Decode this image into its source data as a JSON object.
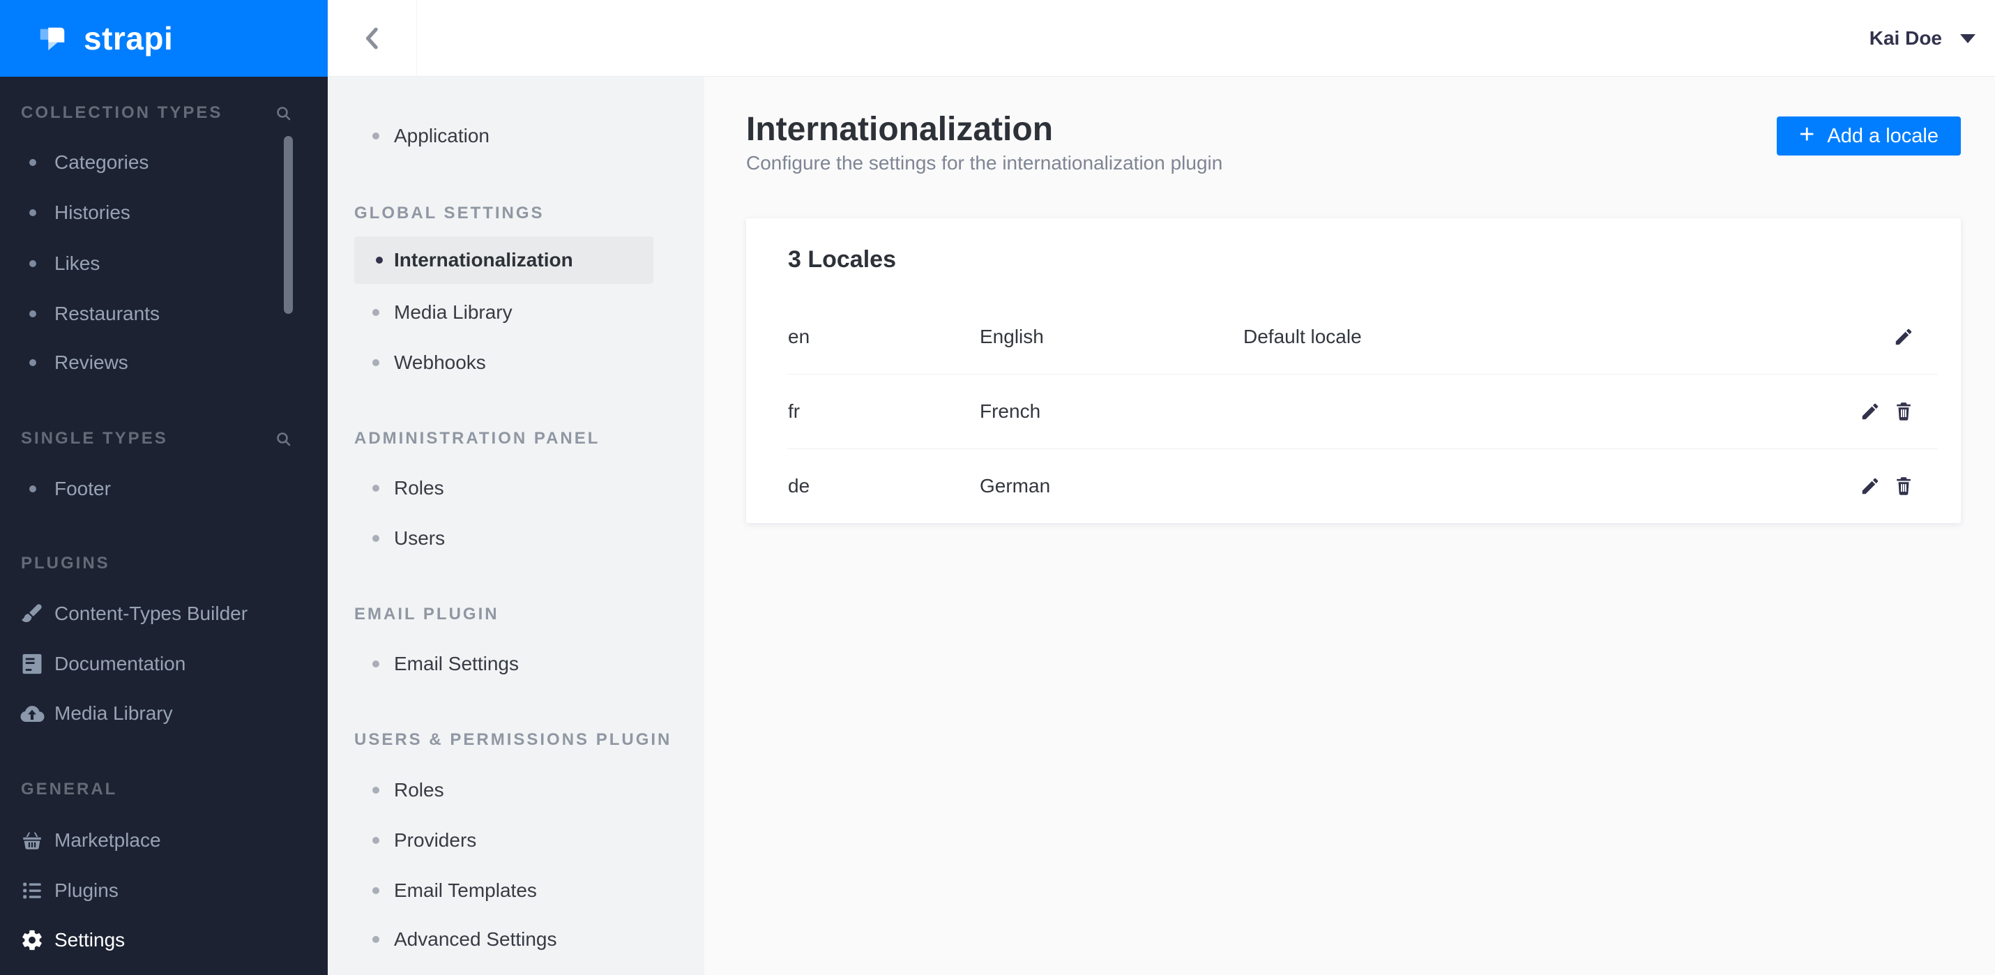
{
  "brand": {
    "wordmark": "strapi"
  },
  "topbar": {
    "user_name": "Kai Doe"
  },
  "colors": {
    "accent": "#007eff",
    "sidebar_bg": "#1c2231",
    "active_pill": "#e9eaeb",
    "icon_dark": "#32324d"
  },
  "main_sidebar": {
    "sections": [
      {
        "label": "COLLECTION TYPES",
        "has_search": true,
        "items": [
          {
            "label": "Categories"
          },
          {
            "label": "Histories"
          },
          {
            "label": "Likes"
          },
          {
            "label": "Restaurants"
          },
          {
            "label": "Reviews"
          }
        ]
      },
      {
        "label": "SINGLE TYPES",
        "has_search": true,
        "items": [
          {
            "label": "Footer"
          }
        ]
      },
      {
        "label": "PLUGINS",
        "items": [
          {
            "label": "Content-Types Builder",
            "icon": "brush-icon"
          },
          {
            "label": "Documentation",
            "icon": "book-icon"
          },
          {
            "label": "Media Library",
            "icon": "cloud-upload-icon"
          }
        ]
      },
      {
        "label": "GENERAL",
        "items": [
          {
            "label": "Marketplace",
            "icon": "basket-icon"
          },
          {
            "label": "Plugins",
            "icon": "list-icon"
          },
          {
            "label": "Settings",
            "icon": "gear-icon",
            "active": true
          }
        ]
      }
    ]
  },
  "settings_nav": {
    "top_items": [
      {
        "label": "Application"
      }
    ],
    "sections": [
      {
        "label": "GLOBAL SETTINGS",
        "items": [
          {
            "label": "Internationalization",
            "active": true
          },
          {
            "label": "Media Library"
          },
          {
            "label": "Webhooks"
          }
        ]
      },
      {
        "label": "ADMINISTRATION PANEL",
        "items": [
          {
            "label": "Roles"
          },
          {
            "label": "Users"
          }
        ]
      },
      {
        "label": "EMAIL PLUGIN",
        "items": [
          {
            "label": "Email Settings"
          }
        ]
      },
      {
        "label": "USERS & PERMISSIONS PLUGIN",
        "items": [
          {
            "label": "Roles"
          },
          {
            "label": "Providers"
          },
          {
            "label": "Email Templates"
          },
          {
            "label": "Advanced Settings"
          }
        ]
      }
    ]
  },
  "content": {
    "title": "Internationalization",
    "subtitle": "Configure the settings for the internationalization plugin",
    "plus": "+",
    "add_locale_button": "Add a locale",
    "card": {
      "title": "3 Locales",
      "rows": [
        {
          "code": "en",
          "name": "English",
          "status": "Default locale"
        },
        {
          "code": "fr",
          "name": "French",
          "status": ""
        },
        {
          "code": "de",
          "name": "German",
          "status": ""
        }
      ]
    }
  }
}
